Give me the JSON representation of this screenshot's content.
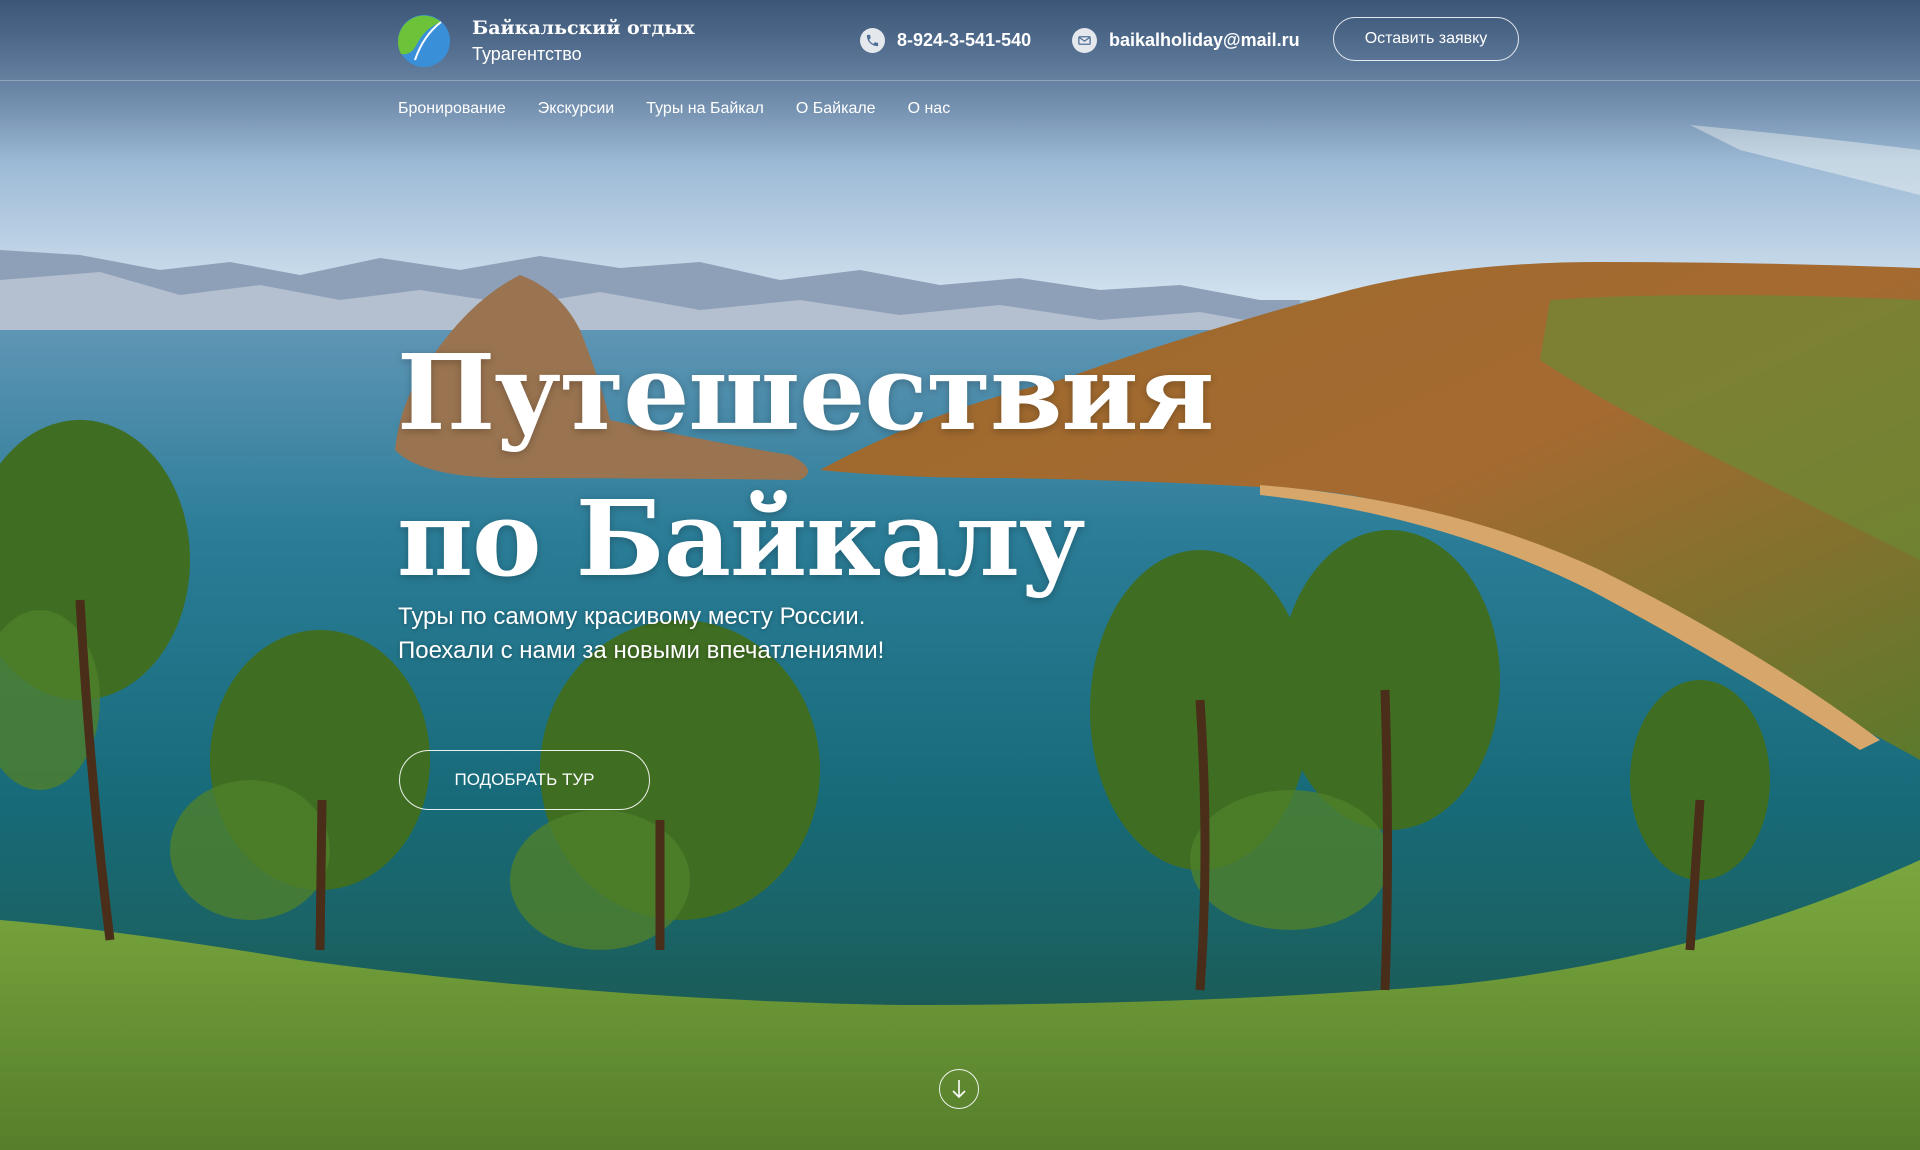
{
  "header": {
    "brand_name": "Байкальский отдых",
    "brand_sub": "Турагентство",
    "phone": "8-924-3-541-540",
    "email": "baikalholiday@mail.ru",
    "request_button": "Оставить заявку",
    "icons": {
      "logo": "logo-leaf-icon",
      "phone": "phone-icon",
      "email": "mail-icon"
    }
  },
  "nav": {
    "items": [
      {
        "label": "Бронирование"
      },
      {
        "label": "Экскурсии"
      },
      {
        "label": "Туры на Байкал"
      },
      {
        "label": "О Байкале"
      },
      {
        "label": "О нас"
      }
    ]
  },
  "hero": {
    "title_line1": "Путешествия",
    "title_line2": "по Байкалу",
    "subtitle_line1": "Туры по самому красивому месту России.",
    "subtitle_line2": "Поехали с нами за новыми впечатлениями!",
    "cta": "Подобрать тур",
    "scroll_icon": "arrow-down-icon"
  },
  "colors": {
    "logo_green": "#6cc33a",
    "logo_blue": "#3a8fd9",
    "text": "#ffffff"
  }
}
